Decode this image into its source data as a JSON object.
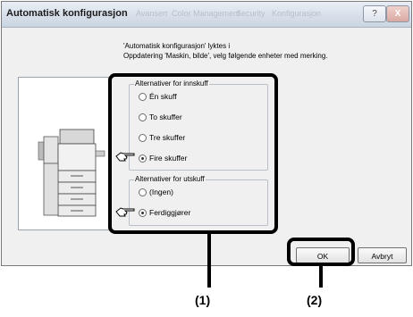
{
  "window": {
    "title": "Automatisk konfigurasjon",
    "background_tabs": [
      "Avansert",
      "Color Management",
      "Security",
      "Konfigurasjon"
    ],
    "help_glyph": "?",
    "close_glyph": "X"
  },
  "message": {
    "line1": "'Automatisk konfigurasjon' lyktes i",
    "line2": "Oppdatering 'Maskin, bilde', velg følgende enheter med merking."
  },
  "input_group": {
    "label": "Alternativer for innskuff",
    "options": [
      {
        "label": "Én skuff",
        "selected": false
      },
      {
        "label": "To skuffer",
        "selected": false
      },
      {
        "label": "Tre skuffer",
        "selected": false
      },
      {
        "label": "Fire skuffer",
        "selected": true
      }
    ]
  },
  "output_group": {
    "label": "Alternativer for utskuff",
    "options": [
      {
        "label": "(Ingen)",
        "selected": false
      },
      {
        "label": "Ferdiggjører",
        "selected": true
      }
    ]
  },
  "buttons": {
    "ok": "OK",
    "cancel": "Avbryt"
  },
  "callouts": {
    "one": "(1)",
    "two": "(2)"
  },
  "icons": [
    "pointing-hand-icon",
    "printer-illustration",
    "help-icon",
    "close-icon"
  ]
}
